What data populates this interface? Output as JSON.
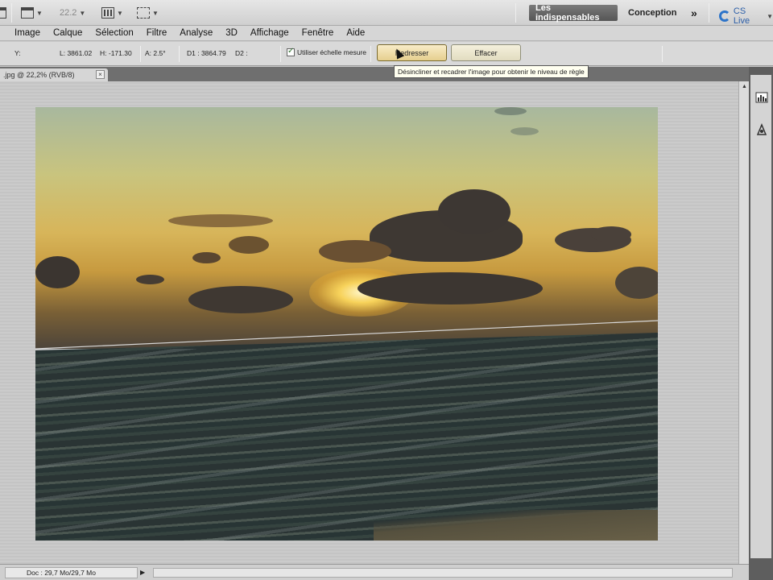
{
  "app_bar": {
    "zoom_value": "22.2",
    "workspaces": {
      "active": "Les indispensables",
      "other": "Conception",
      "more": "»"
    },
    "cs_live_label": "CS Live",
    "icons": [
      "layout-icon",
      "grid-icon",
      "arrange-icon"
    ]
  },
  "menu": [
    "Image",
    "Calque",
    "Sélection",
    "Filtre",
    "Analyse",
    "3D",
    "Affichage",
    "Fenêtre",
    "Aide"
  ],
  "options_bar": {
    "y_label": "Y:",
    "l_label": "L: 3861.02",
    "h_label": "H: -171.30",
    "a_label": "A: 2.5°",
    "d1_label": "D1 : 3864.79",
    "d2_label": "D2 :",
    "checkbox_label": "Utiliser échelle mesure",
    "checkbox_checked": true,
    "redress_button": "Redresser",
    "clear_button": "Effacer"
  },
  "tooltip": "Désincliner et recadrer l'image pour obtenir le niveau de règle",
  "document_tab": {
    "title": ".jpg @ 22,2% (RVB/8)",
    "close": "×"
  },
  "status_bar": {
    "doc_info": "Doc : 29,7 Mo/29,7 Mo",
    "arrow": "▶"
  },
  "colors": {
    "active_workspace_bg": "#555555",
    "cs_live_blue": "#2d74c9",
    "button_face": "#e2dcc0"
  },
  "measure_angle_deg": 2.5
}
